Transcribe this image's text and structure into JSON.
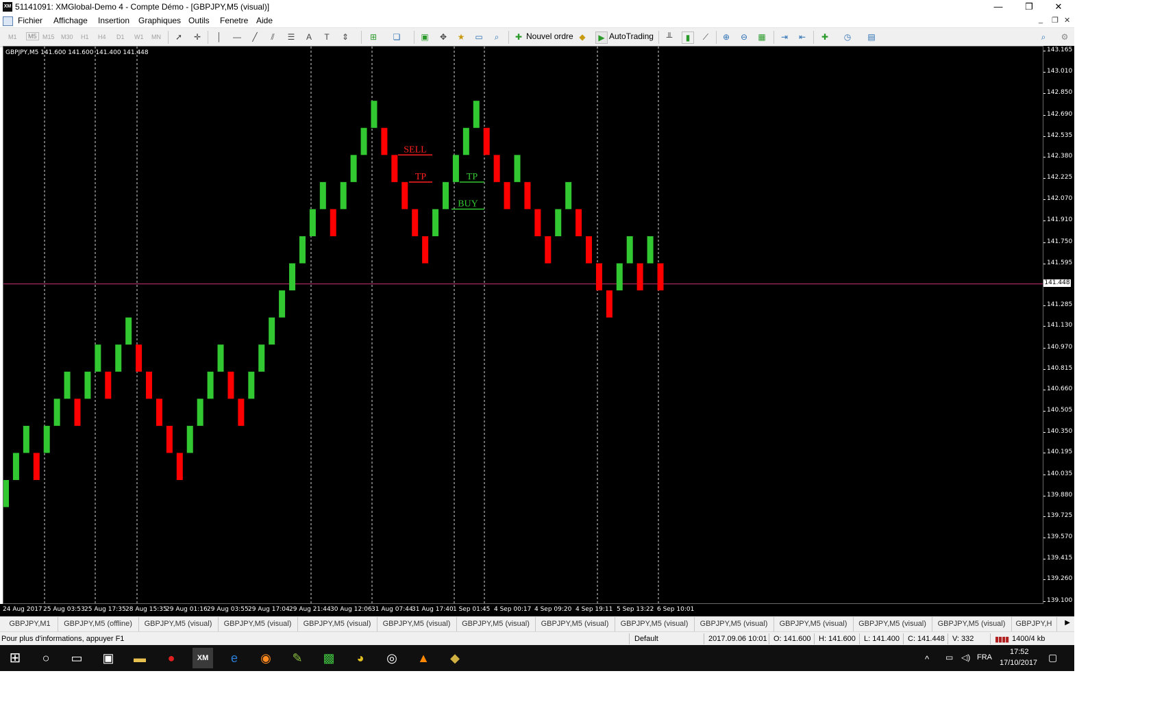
{
  "window": {
    "title": "51141091: XMGlobal-Demo 4 - Compte Démo - [GBPJPY,M5 (visual)]",
    "app_logo": "XM",
    "minimize": "—",
    "restore": "❐",
    "close": "✕"
  },
  "menu": {
    "items": [
      "Fichier",
      "Affichage",
      "Insertion",
      "Graphiques",
      "Outils",
      "Fenetre",
      "Aide"
    ],
    "mdi": {
      "minimize": "_",
      "restore": "❐",
      "close": "✕"
    }
  },
  "toolbar": {
    "timeframes": [
      "M1",
      "M5",
      "M15",
      "M30",
      "H1",
      "H4",
      "D1",
      "W1",
      "MN"
    ],
    "new_order": "Nouvel ordre",
    "autotrading": "AutoTrading",
    "icons": [
      "cursor-icon",
      "crosshair-icon",
      "vertical-line-icon",
      "horizontal-line-icon",
      "trendline-icon",
      "channel-icon",
      "fibonacci-icon",
      "text-icon",
      "label-icon",
      "arrows-icon",
      "new-chart-icon",
      "profiles-icon",
      "market-watch-icon",
      "navigator-icon",
      "data-window-icon",
      "terminal-icon",
      "strategy-tester-icon",
      "bar-chart-icon",
      "candle-chart-icon",
      "line-chart-icon",
      "zoom-in-icon",
      "zoom-out-icon",
      "tile-windows-icon",
      "autoscroll-icon",
      "chart-shift-icon",
      "indicators-icon",
      "periodicity-icon",
      "templates-icon",
      "search-icon"
    ]
  },
  "chart": {
    "symbol_info": "GBPJPY,M5  141.600 141.600 141.400 141.448",
    "background": "#000000",
    "bull_color": "#32c832",
    "bear_color": "#ff0000",
    "current_line_color": "#c83278",
    "current_price": "141.448",
    "price_ticks": [
      "143.165",
      "143.010",
      "142.850",
      "142.690",
      "142.535",
      "142.380",
      "142.225",
      "142.070",
      "141.910",
      "141.750",
      "141.595",
      "141.285",
      "141.130",
      "140.970",
      "140.815",
      "140.660",
      "140.505",
      "140.350",
      "140.195",
      "140.035",
      "139.880",
      "139.725",
      "139.570",
      "139.415",
      "139.260",
      "139.100"
    ],
    "time_labels": [
      "24 Aug 2017",
      "25 Aug 03:53",
      "25 Aug 17:35",
      "28 Aug 15:35",
      "29 Aug 01:16",
      "29 Aug 03:55",
      "29 Aug 17:04",
      "29 Aug 21:44",
      "30 Aug 12:06",
      "31 Aug 07:44",
      "31 Aug 17:40",
      "1 Sep 01:45",
      "4 Sep 00:17",
      "4 Sep 09:20",
      "4 Sep 19:11",
      "5 Sep 13:22",
      "6 Sep 10:01"
    ],
    "annotations": [
      {
        "text": "SELL",
        "color": "#ff2020",
        "price": 142.4
      },
      {
        "text": "TP",
        "color": "#ff2020",
        "price": 142.2
      },
      {
        "text": "TP",
        "color": "#32c832",
        "price": 142.2
      },
      {
        "text": "BUY",
        "color": "#32c832",
        "price": 142.0
      }
    ]
  },
  "chart_data": {
    "type": "renko",
    "symbol": "GBPJPY",
    "timeframe": "M5",
    "box_size": 0.2,
    "bricks": [
      {
        "dir": "up",
        "open": 139.8,
        "close": 140.0
      },
      {
        "dir": "up",
        "open": 140.0,
        "close": 140.2
      },
      {
        "dir": "up",
        "open": 140.2,
        "close": 140.4
      },
      {
        "dir": "down",
        "open": 140.2,
        "close": 140.0
      },
      {
        "dir": "up",
        "open": 140.2,
        "close": 140.4
      },
      {
        "dir": "up",
        "open": 140.4,
        "close": 140.6
      },
      {
        "dir": "up",
        "open": 140.6,
        "close": 140.8
      },
      {
        "dir": "down",
        "open": 140.6,
        "close": 140.4
      },
      {
        "dir": "up",
        "open": 140.6,
        "close": 140.8
      },
      {
        "dir": "up",
        "open": 140.8,
        "close": 141.0
      },
      {
        "dir": "down",
        "open": 140.8,
        "close": 140.6
      },
      {
        "dir": "up",
        "open": 140.8,
        "close": 141.0
      },
      {
        "dir": "up",
        "open": 141.0,
        "close": 141.2
      },
      {
        "dir": "down",
        "open": 141.0,
        "close": 140.8
      },
      {
        "dir": "down",
        "open": 140.8,
        "close": 140.6
      },
      {
        "dir": "down",
        "open": 140.6,
        "close": 140.4
      },
      {
        "dir": "down",
        "open": 140.4,
        "close": 140.2
      },
      {
        "dir": "down",
        "open": 140.2,
        "close": 140.0
      },
      {
        "dir": "up",
        "open": 140.2,
        "close": 140.4
      },
      {
        "dir": "up",
        "open": 140.4,
        "close": 140.6
      },
      {
        "dir": "up",
        "open": 140.6,
        "close": 140.8
      },
      {
        "dir": "up",
        "open": 140.8,
        "close": 141.0
      },
      {
        "dir": "down",
        "open": 140.8,
        "close": 140.6
      },
      {
        "dir": "down",
        "open": 140.6,
        "close": 140.4
      },
      {
        "dir": "up",
        "open": 140.6,
        "close": 140.8
      },
      {
        "dir": "up",
        "open": 140.8,
        "close": 141.0
      },
      {
        "dir": "up",
        "open": 141.0,
        "close": 141.2
      },
      {
        "dir": "up",
        "open": 141.2,
        "close": 141.4
      },
      {
        "dir": "up",
        "open": 141.4,
        "close": 141.6
      },
      {
        "dir": "up",
        "open": 141.6,
        "close": 141.8
      },
      {
        "dir": "up",
        "open": 141.8,
        "close": 142.0
      },
      {
        "dir": "up",
        "open": 142.0,
        "close": 142.2
      },
      {
        "dir": "down",
        "open": 142.0,
        "close": 141.8
      },
      {
        "dir": "up",
        "open": 142.0,
        "close": 142.2
      },
      {
        "dir": "up",
        "open": 142.2,
        "close": 142.4
      },
      {
        "dir": "up",
        "open": 142.4,
        "close": 142.6
      },
      {
        "dir": "up",
        "open": 142.6,
        "close": 142.8
      },
      {
        "dir": "down",
        "open": 142.6,
        "close": 142.4
      },
      {
        "dir": "down",
        "open": 142.4,
        "close": 142.2
      },
      {
        "dir": "down",
        "open": 142.2,
        "close": 142.0
      },
      {
        "dir": "down",
        "open": 142.0,
        "close": 141.8
      },
      {
        "dir": "down",
        "open": 141.8,
        "close": 141.6
      },
      {
        "dir": "up",
        "open": 141.8,
        "close": 142.0
      },
      {
        "dir": "up",
        "open": 142.0,
        "close": 142.2
      },
      {
        "dir": "up",
        "open": 142.2,
        "close": 142.4
      },
      {
        "dir": "up",
        "open": 142.4,
        "close": 142.6
      },
      {
        "dir": "up",
        "open": 142.6,
        "close": 142.8
      },
      {
        "dir": "down",
        "open": 142.6,
        "close": 142.4
      },
      {
        "dir": "down",
        "open": 142.4,
        "close": 142.2
      },
      {
        "dir": "down",
        "open": 142.2,
        "close": 142.0
      },
      {
        "dir": "up",
        "open": 142.2,
        "close": 142.4
      },
      {
        "dir": "down",
        "open": 142.2,
        "close": 142.0
      },
      {
        "dir": "down",
        "open": 142.0,
        "close": 141.8
      },
      {
        "dir": "down",
        "open": 141.8,
        "close": 141.6
      },
      {
        "dir": "up",
        "open": 141.8,
        "close": 142.0
      },
      {
        "dir": "up",
        "open": 142.0,
        "close": 142.2
      },
      {
        "dir": "down",
        "open": 142.0,
        "close": 141.8
      },
      {
        "dir": "down",
        "open": 141.8,
        "close": 141.6
      },
      {
        "dir": "down",
        "open": 141.6,
        "close": 141.4
      },
      {
        "dir": "down",
        "open": 141.4,
        "close": 141.2
      },
      {
        "dir": "up",
        "open": 141.4,
        "close": 141.6
      },
      {
        "dir": "up",
        "open": 141.6,
        "close": 141.8
      },
      {
        "dir": "down",
        "open": 141.6,
        "close": 141.4
      },
      {
        "dir": "up",
        "open": 141.6,
        "close": 141.8
      },
      {
        "dir": "down",
        "open": 141.6,
        "close": 141.4
      }
    ],
    "ylim": [
      139.1,
      143.165
    ],
    "grid": false,
    "current_price": 141.448
  },
  "tabs": [
    "GBPJPY,M1",
    "GBPJPY,M5 (offline)",
    "GBPJPY,M5 (visual)",
    "GBPJPY,M5 (visual)",
    "GBPJPY,M5 (visual)",
    "GBPJPY,M5 (visual)",
    "GBPJPY,M5 (visual)",
    "GBPJPY,M5 (visual)",
    "GBPJPY,M5 (visual)",
    "GBPJPY,M5 (visual)",
    "GBPJPY,M5 (visual)",
    "GBPJPY,M5 (visual)",
    "GBPJPY,M5 (visual)",
    "GBPJPY,H"
  ],
  "status": {
    "help": "Pour plus d'informations, appuyer F1",
    "profile": "Default",
    "datetime": "2017.09.06 10:01",
    "open": "O: 141.600",
    "high": "H: 141.600",
    "low": "L: 141.400",
    "close": "C: 141.448",
    "volume": "V: 332",
    "traffic": "1400/4 kb"
  },
  "taskbar": {
    "lang": "FRA",
    "time": "17:52",
    "date": "17/10/2017"
  }
}
